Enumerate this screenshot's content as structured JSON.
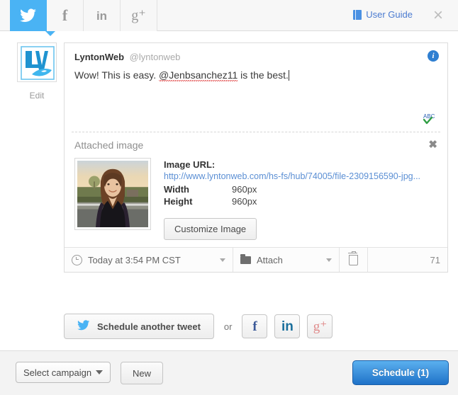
{
  "topbar": {
    "tabs": [
      {
        "id": "twitter",
        "icon": "twitter-bird-icon",
        "label": "Twitter",
        "active": true
      },
      {
        "id": "facebook",
        "icon": "facebook-icon",
        "label": "f",
        "active": false
      },
      {
        "id": "linkedin",
        "icon": "linkedin-icon",
        "label": "in",
        "active": false
      },
      {
        "id": "googleplus",
        "icon": "google-plus-icon",
        "label": "g⁺",
        "active": false
      }
    ],
    "user_guide_label": "User Guide",
    "user_guide_icon": "book-icon",
    "close_icon": "close-icon",
    "close_label": "×",
    "active_tab_color": "#4ab3f4"
  },
  "composer": {
    "avatar_alt": "LyntonWeb logo",
    "edit_label": "Edit",
    "account_name": "LyntonWeb",
    "account_handle": "@lyntonweb",
    "info_icon": "info-icon",
    "info_label": "i",
    "tweet_text_before": "Wow! This is easy. ",
    "tweet_mention": "@Jenbsanchez11",
    "tweet_text_after": " is the best.",
    "spellcheck_icon": "spellcheck-abc-icon",
    "spellcheck_label": "ABC"
  },
  "attached_image": {
    "title": "Attached image",
    "close_icon": "close-icon",
    "close_label": "✖",
    "url_label": "Image URL:",
    "url_value": "http://www.lyntonweb.com/hs-fs/hub/74005/file-2309156590-jpg...",
    "width_label": "Width",
    "width_value": "960px",
    "height_label": "Height",
    "height_value": "960px",
    "customize_button": "Customize Image",
    "thumbnail_alt": "Photo of a smiling woman outdoors at sunset"
  },
  "toolbar": {
    "schedule_time": "Today at 3:54 PM CST",
    "clock_icon": "clock-icon",
    "time_caret_icon": "chevron-down-icon",
    "attach_label": "Attach",
    "folder_icon": "folder-icon",
    "attach_caret_icon": "chevron-down-icon",
    "trash_icon": "trash-icon",
    "char_count": "71"
  },
  "actions": {
    "schedule_another_label": "Schedule another tweet",
    "twitter_icon": "twitter-bird-icon",
    "or_label": "or",
    "networks": [
      {
        "id": "facebook",
        "icon": "facebook-icon",
        "glyph": "f",
        "color": "#3b5998"
      },
      {
        "id": "linkedin",
        "icon": "linkedin-icon",
        "glyph": "in",
        "color": "#1a6f9c"
      },
      {
        "id": "googleplus",
        "icon": "google-plus-icon",
        "glyph": "g⁺",
        "color": "#e08b8b"
      }
    ]
  },
  "footer": {
    "select_campaign_label": "Select campaign",
    "select_caret_icon": "chevron-down-icon",
    "new_button_label": "New",
    "schedule_button_label": "Schedule (1)",
    "schedule_button_color": "#2a86db"
  }
}
